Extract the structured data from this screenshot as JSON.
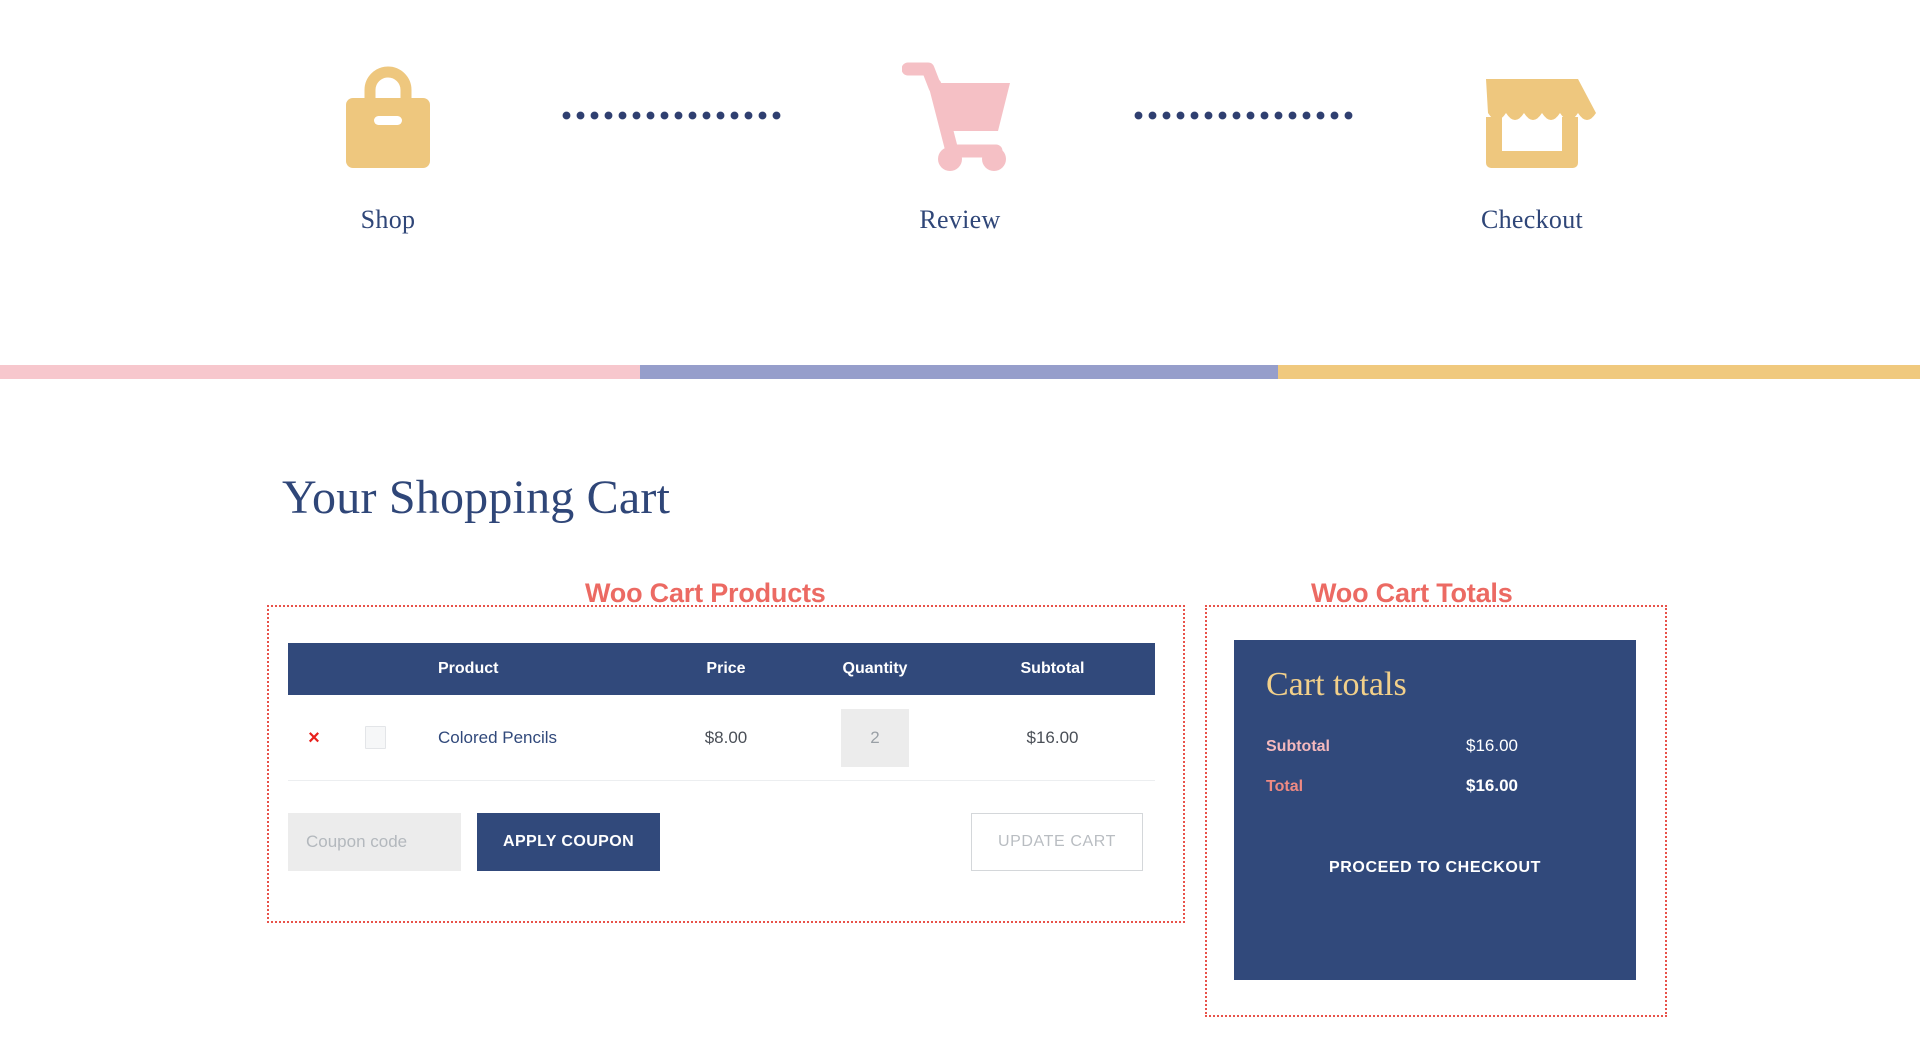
{
  "steps": [
    {
      "label": "Shop",
      "icon": "shopping-bag-icon",
      "color": "#eec77e"
    },
    {
      "label": "Review",
      "icon": "shopping-cart-icon",
      "color": "#f5c0c5"
    },
    {
      "label": "Checkout",
      "icon": "storefront-icon",
      "color": "#eec77e"
    }
  ],
  "progress_segments": [
    {
      "name": "segment-pink",
      "color": "#f7c7cd"
    },
    {
      "name": "segment-periwinkle",
      "color": "#969ecb"
    },
    {
      "name": "segment-gold",
      "color": "#f0c97e"
    }
  ],
  "page_title": "Your Shopping Cart",
  "annotations": {
    "products": "Woo Cart Products",
    "totals": "Woo Cart Totals"
  },
  "cart_table": {
    "columns": [
      "Product",
      "Price",
      "Quantity",
      "Subtotal"
    ],
    "rows": [
      {
        "remove": "×",
        "thumbnail": "image-placeholder-icon",
        "product": "Colored Pencils",
        "price": "$8.00",
        "quantity": "2",
        "subtotal": "$16.00"
      }
    ]
  },
  "coupon": {
    "placeholder": "Coupon code",
    "value": "",
    "apply_label": "APPLY COUPON",
    "update_label": "UPDATE CART"
  },
  "totals": {
    "title": "Cart totals",
    "subtotal_label": "Subtotal",
    "subtotal_value": "$16.00",
    "total_label": "Total",
    "total_value": "$16.00",
    "checkout_label": "PROCEED TO CHECKOUT"
  },
  "colors": {
    "navy": "#31497b",
    "coral": "#ec6a63",
    "gold": "#eec77e",
    "pink": "#f5c0c5"
  }
}
